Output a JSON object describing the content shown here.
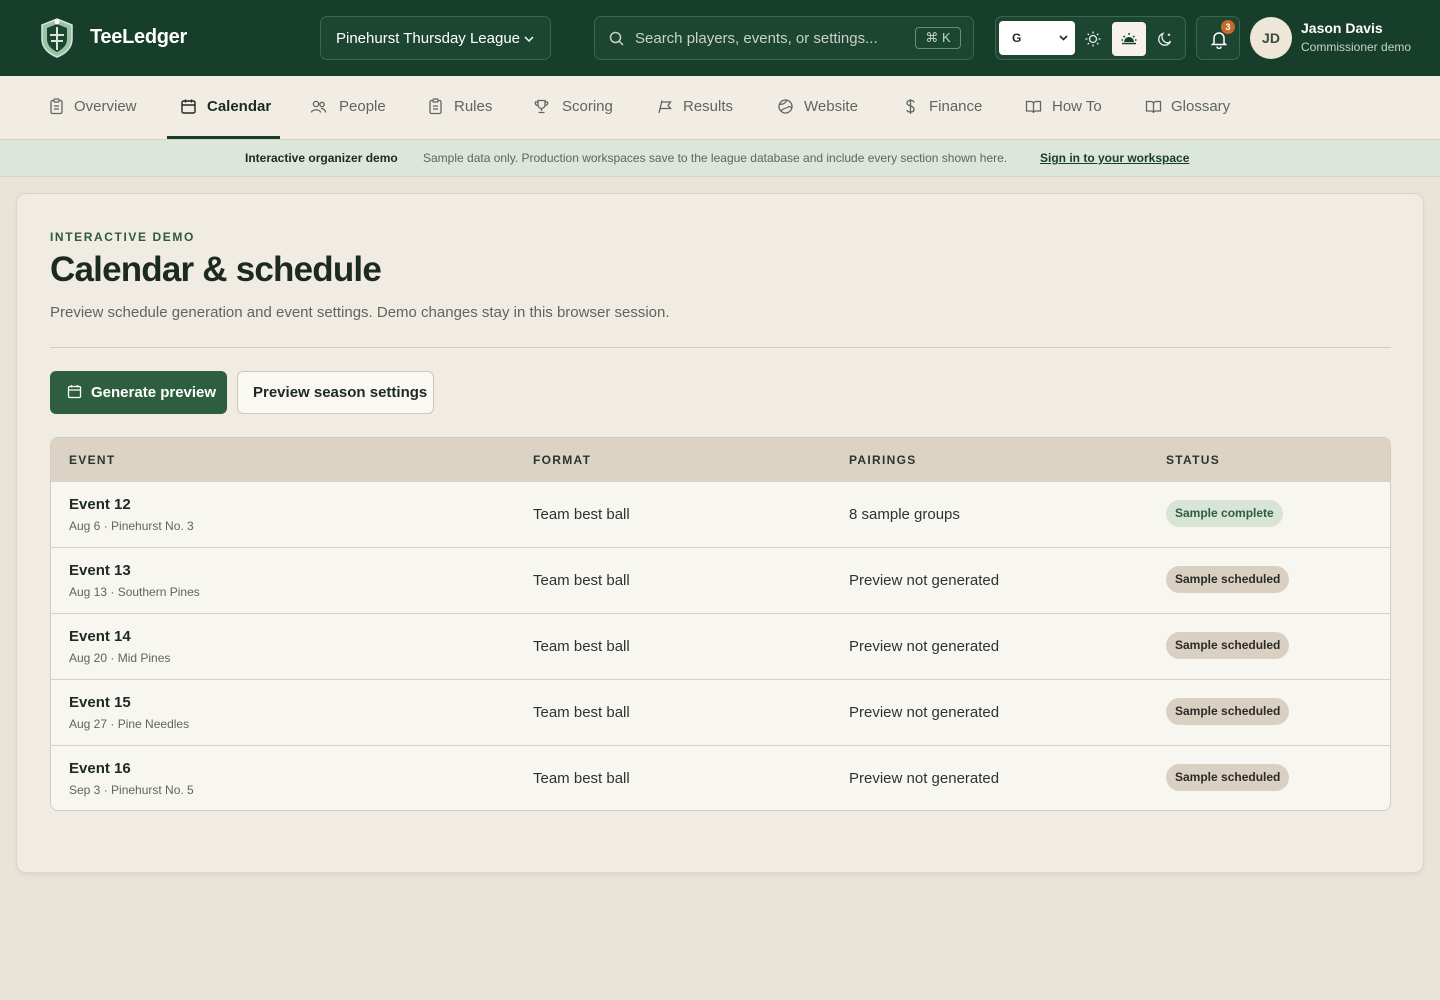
{
  "app": {
    "brand": "TeeLedger",
    "league": "Pinehurst Thursday League",
    "search_placeholder": "Search players, events, or settings...",
    "search_shortcut": "⌘ K",
    "theme_value": "G",
    "notification_count": "3",
    "user": {
      "initials": "JD",
      "name": "Jason Davis",
      "role": "Commissioner demo"
    }
  },
  "nav": {
    "tabs": [
      {
        "label": "Overview",
        "icon": "clipboard-icon"
      },
      {
        "label": "Calendar",
        "icon": "calendar-icon",
        "active": true
      },
      {
        "label": "People",
        "icon": "people-icon"
      },
      {
        "label": "Rules",
        "icon": "clipboard-icon"
      },
      {
        "label": "Scoring",
        "icon": "trophy-icon"
      },
      {
        "label": "Results",
        "icon": "flag-icon"
      },
      {
        "label": "Website",
        "icon": "globe-icon"
      },
      {
        "label": "Finance",
        "icon": "dollar-icon"
      },
      {
        "label": "How To",
        "icon": "book-icon"
      },
      {
        "label": "Glossary",
        "icon": "book-icon"
      }
    ]
  },
  "banner": {
    "title": "Interactive organizer demo",
    "text": "Sample data only. Production workspaces save to the league database and include every section shown here.",
    "link": "Sign in to your workspace"
  },
  "page": {
    "eyebrow": "INTERACTIVE DEMO",
    "title": "Calendar & schedule",
    "subtitle": "Preview schedule generation and event settings. Demo changes stay in this browser session.",
    "primary_button": "Generate preview",
    "secondary_button": "Preview season settings"
  },
  "table": {
    "headers": [
      "EVENT",
      "FORMAT",
      "PAIRINGS",
      "STATUS"
    ],
    "rows": [
      {
        "event": "Event 12",
        "meta": "Aug 6 · Pinehurst No. 3",
        "format": "Team best ball",
        "pairings": "8 sample groups",
        "status": "Sample complete"
      },
      {
        "event": "Event 13",
        "meta": "Aug 13 · Southern Pines",
        "format": "Team best ball",
        "pairings": "Preview not generated",
        "status": "Sample scheduled"
      },
      {
        "event": "Event 14",
        "meta": "Aug 20 · Mid Pines",
        "format": "Team best ball",
        "pairings": "Preview not generated",
        "status": "Sample scheduled"
      },
      {
        "event": "Event 15",
        "meta": "Aug 27 · Pine Needles",
        "format": "Team best ball",
        "pairings": "Preview not generated",
        "status": "Sample scheduled"
      },
      {
        "event": "Event 16",
        "meta": "Sep 3 · Pinehurst No. 5",
        "format": "Team best ball",
        "pairings": "Preview not generated",
        "status": "Sample scheduled"
      }
    ]
  },
  "colors": {
    "brand_green": "#173d2b",
    "primary_button": "#2d5e40",
    "notification_badge": "#c56a2c",
    "status_complete": "#d7e4d6",
    "status_scheduled": "#d9d0c2"
  }
}
